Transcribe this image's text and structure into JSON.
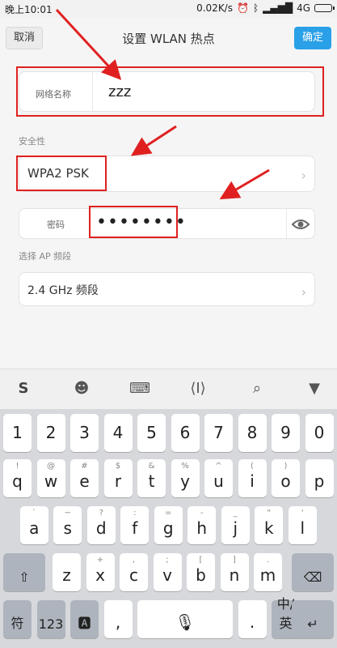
{
  "status_bar": {
    "time": "晚上10:01",
    "speed": "0.02K/s",
    "network": "4G",
    "icons": [
      "alarm-icon",
      "bluetooth-icon",
      "signal-icon",
      "battery-icon"
    ]
  },
  "header": {
    "cancel_label": "取消",
    "title": "设置 WLAN 热点",
    "confirm_label": "确定"
  },
  "form": {
    "network_name_label": "网络名称",
    "network_name_value": "zzz",
    "security_section_label": "安全性",
    "security_value": "WPA2 PSK",
    "password_label": "密码",
    "password_value": "••••••••",
    "band_section_label": "选择 AP 频段",
    "band_value": "2.4 GHz 频段"
  },
  "keyboard": {
    "toolbar_icons": [
      "sogou-logo-icon",
      "emoji-icon",
      "keyboard-icon",
      "cursor-move-icon",
      "search-icon",
      "collapse-icon"
    ],
    "row1": [
      "1",
      "2",
      "3",
      "4",
      "5",
      "6",
      "7",
      "8",
      "9",
      "0"
    ],
    "row2": {
      "keys": [
        "q",
        "w",
        "e",
        "r",
        "t",
        "y",
        "u",
        "i",
        "o",
        "p"
      ],
      "subs": [
        "!",
        "@",
        "#",
        "$",
        "&",
        "%",
        "^",
        "(",
        ")",
        ""
      ]
    },
    "row3": {
      "keys": [
        "a",
        "s",
        "d",
        "f",
        "g",
        "h",
        "j",
        "k",
        "l"
      ],
      "subs": [
        "`",
        "~",
        "?",
        ":",
        "=",
        "-",
        "_",
        "\"",
        "'"
      ]
    },
    "row4": {
      "keys": [
        "z",
        "x",
        "c",
        "v",
        "b",
        "n",
        "m"
      ],
      "subs": [
        "",
        "+",
        ",",
        ";",
        "[",
        "]",
        "."
      ]
    },
    "bottom": {
      "chinese": "符",
      "num": "123",
      "comma": ",",
      "period": ".",
      "lang": "中/英"
    }
  },
  "colors": {
    "accent": "#2aa0e8",
    "annotation": "#e02020"
  }
}
